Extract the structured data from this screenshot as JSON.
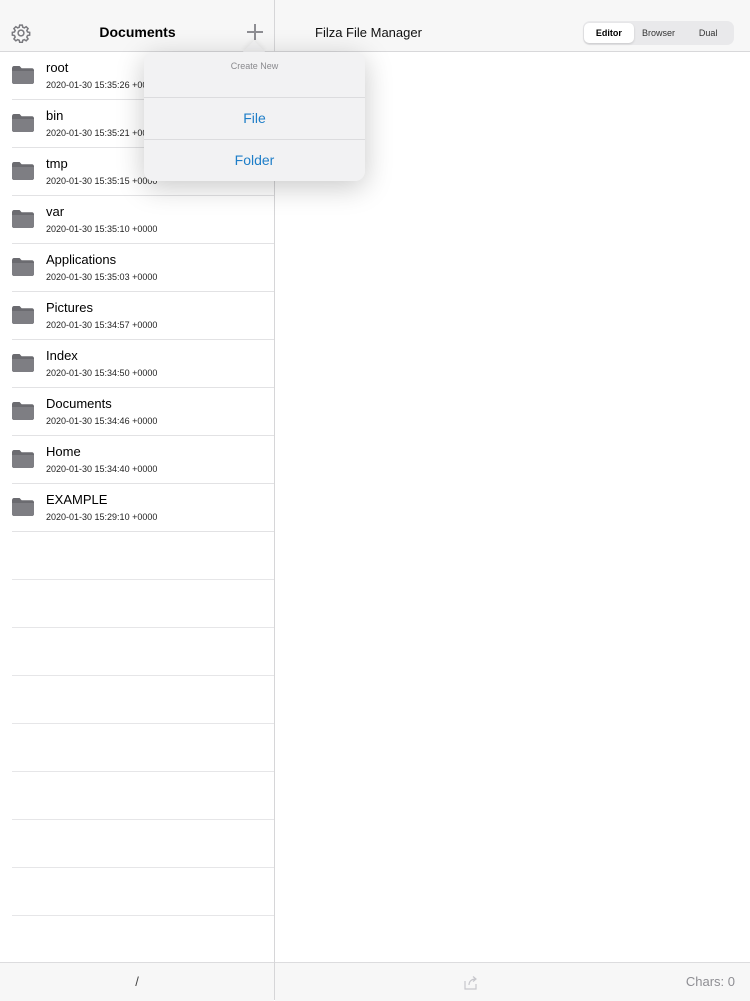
{
  "left_nav": {
    "title": "Documents",
    "settings_icon": "gear-icon",
    "add_icon": "plus-icon"
  },
  "files": [
    {
      "name": "root",
      "date": "2020-01-30 15:35:26 +0000"
    },
    {
      "name": "bin",
      "date": "2020-01-30 15:35:21 +0000"
    },
    {
      "name": "tmp",
      "date": "2020-01-30 15:35:15 +0000"
    },
    {
      "name": "var",
      "date": "2020-01-30 15:35:10 +0000"
    },
    {
      "name": "Applications",
      "date": "2020-01-30 15:35:03 +0000"
    },
    {
      "name": "Pictures",
      "date": "2020-01-30 15:34:57 +0000"
    },
    {
      "name": "Index",
      "date": "2020-01-30 15:34:50 +0000"
    },
    {
      "name": "Documents",
      "date": "2020-01-30 15:34:46 +0000"
    },
    {
      "name": "Home",
      "date": "2020-01-30 15:34:40 +0000"
    },
    {
      "name": "EXAMPLE",
      "date": "2020-01-30 15:29:10 +0000"
    }
  ],
  "left_bottom": {
    "path": "/"
  },
  "right_nav": {
    "title": "Filza File Manager",
    "segments": [
      {
        "label": "Editor",
        "active": true
      },
      {
        "label": "Browser",
        "active": false
      },
      {
        "label": "Dual",
        "active": false
      }
    ]
  },
  "right_bottom": {
    "chars": "Chars: 0",
    "share_icon": "share-icon"
  },
  "popover": {
    "title": "Create New",
    "items": [
      {
        "label": "File"
      },
      {
        "label": "Folder"
      }
    ]
  },
  "colors": {
    "accent": "#1e7ec8",
    "folder": "#6b6b70"
  }
}
